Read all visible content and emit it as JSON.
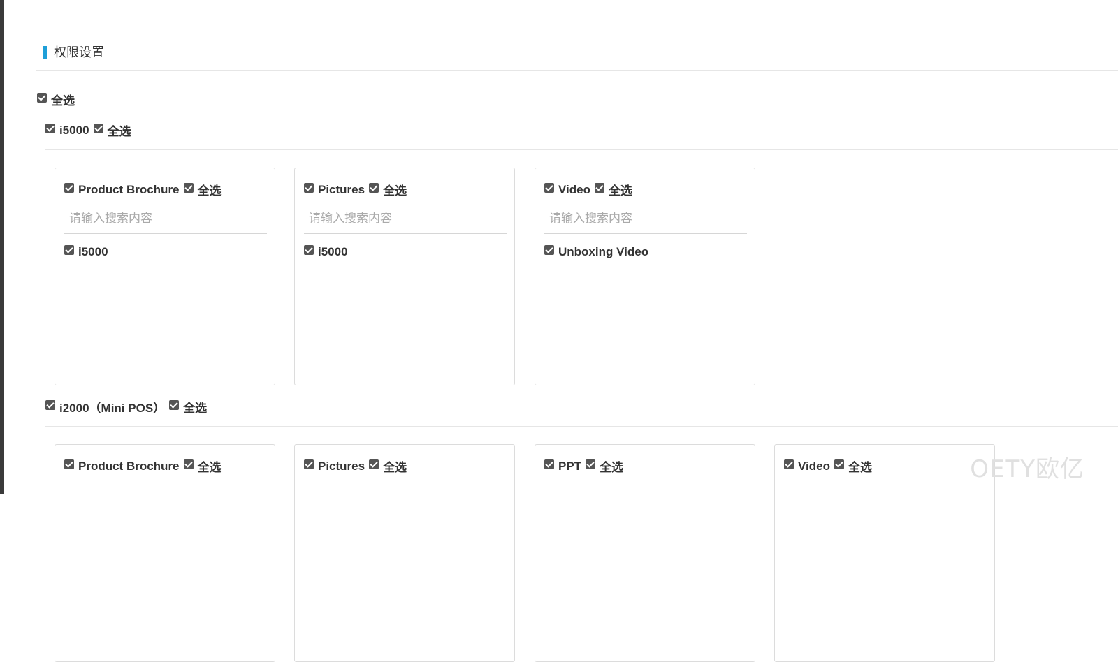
{
  "section": {
    "title": "权限设置"
  },
  "select_all_label": "全选",
  "groups": [
    {
      "label": "i5000",
      "select_all": "全选",
      "cards": [
        {
          "title": "Product Brochure",
          "select_all": "全选",
          "search_placeholder": "请输入搜索内容",
          "items": [
            "i5000"
          ]
        },
        {
          "title": "Pictures",
          "select_all": "全选",
          "search_placeholder": "请输入搜索内容",
          "items": [
            "i5000"
          ]
        },
        {
          "title": "Video",
          "select_all": "全选",
          "search_placeholder": "请输入搜索内容",
          "items": [
            "Unboxing Video"
          ]
        }
      ]
    },
    {
      "label": "i2000（Mini POS）",
      "select_all": "全选",
      "cards": [
        {
          "title": "Product Brochure",
          "select_all": "全选"
        },
        {
          "title": "Pictures",
          "select_all": "全选"
        },
        {
          "title": "PPT",
          "select_all": "全选"
        },
        {
          "title": "Video",
          "select_all": "全选"
        }
      ]
    }
  ],
  "watermark": "OETY欧亿",
  "colors": {
    "accent": "#1e9fd8",
    "checkbox": "#555555",
    "border": "#dcdcdc"
  }
}
